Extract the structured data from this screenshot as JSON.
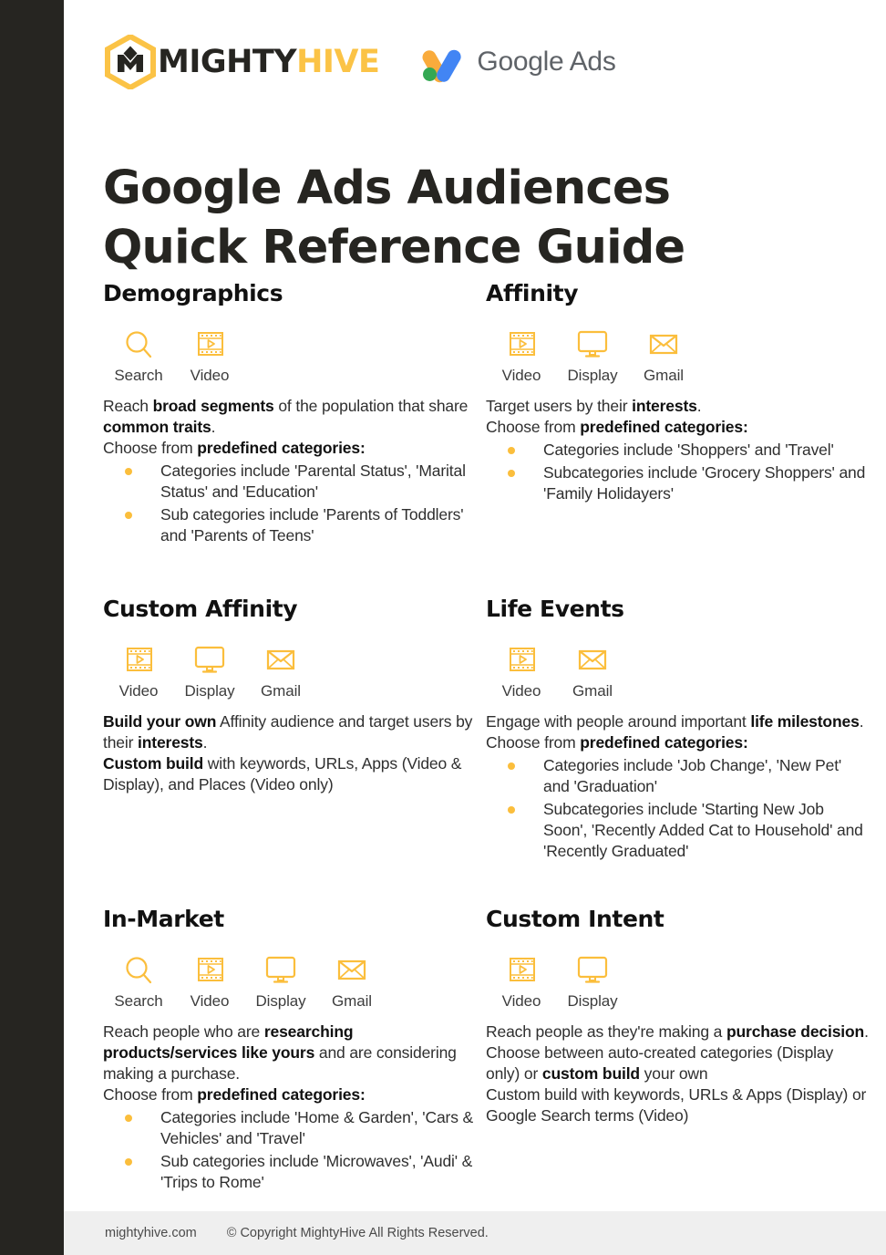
{
  "brand": {
    "mightyhive_mighty": "MIGHTY",
    "mightyhive_hive": "HIVE",
    "google_ads_text": "Google Ads",
    "accent_gold": "#FBC346",
    "bullet_gold": "#FBBE3C",
    "dark": "#262521"
  },
  "title": {
    "line1": "Google Ads Audiences",
    "line2": "Quick Reference Guide"
  },
  "sections": [
    {
      "id": "demographics",
      "title": "Demographics",
      "channels": [
        {
          "icon": "search-icon",
          "label": "Search"
        },
        {
          "icon": "video-icon",
          "label": "Video"
        }
      ],
      "paragraphs": [
        [
          {
            "t": "Reach ",
            "b": false
          },
          {
            "t": "broad segments",
            "b": true
          },
          {
            "t": " of the population that share ",
            "b": false
          },
          {
            "t": "common traits",
            "b": true
          },
          {
            "t": ".",
            "b": false
          }
        ],
        [
          {
            "t": "Choose from ",
            "b": false
          },
          {
            "t": "predefined categories:",
            "b": true
          }
        ]
      ],
      "bullets": [
        "Categories include 'Parental Status', 'Marital Status' and 'Education'",
        "Sub categories include 'Parents of Toddlers' and 'Parents of Teens'"
      ]
    },
    {
      "id": "affinity",
      "title": "Affinity",
      "channels": [
        {
          "icon": "video-icon",
          "label": "Video"
        },
        {
          "icon": "display-icon",
          "label": "Display"
        },
        {
          "icon": "gmail-icon",
          "label": "Gmail"
        }
      ],
      "paragraphs": [
        [
          {
            "t": "Target users by their ",
            "b": false
          },
          {
            "t": "interests",
            "b": true
          },
          {
            "t": ".",
            "b": false
          }
        ],
        [
          {
            "t": "Choose from ",
            "b": false
          },
          {
            "t": "predefined categories:",
            "b": true
          }
        ]
      ],
      "bullets": [
        "Categories include 'Shoppers' and 'Travel'",
        "Subcategories include 'Grocery Shoppers' and 'Family Holidayers'"
      ]
    },
    {
      "id": "custom-affinity",
      "title": "Custom Affinity",
      "channels": [
        {
          "icon": "video-icon",
          "label": "Video"
        },
        {
          "icon": "display-icon",
          "label": "Display"
        },
        {
          "icon": "gmail-icon",
          "label": "Gmail"
        }
      ],
      "paragraphs": [
        [
          {
            "t": "Build your own",
            "b": true
          },
          {
            "t": " Affinity audience and target users by their ",
            "b": false
          },
          {
            "t": "interests",
            "b": true
          },
          {
            "t": ".",
            "b": false
          }
        ],
        [
          {
            "t": "Custom build",
            "b": true
          },
          {
            "t": " with keywords, URLs, Apps (Video & Display), and Places (Video only)",
            "b": false
          }
        ]
      ],
      "bullets": []
    },
    {
      "id": "life-events",
      "title": "Life Events",
      "channels": [
        {
          "icon": "video-icon",
          "label": "Video"
        },
        {
          "icon": "gmail-icon",
          "label": "Gmail"
        }
      ],
      "paragraphs": [
        [
          {
            "t": "Engage with people around important ",
            "b": false
          },
          {
            "t": "life milestones",
            "b": true
          },
          {
            "t": ".",
            "b": false
          }
        ],
        [
          {
            "t": "Choose from ",
            "b": false
          },
          {
            "t": "predefined categories:",
            "b": true
          }
        ]
      ],
      "bullets": [
        "Categories include 'Job Change', 'New Pet' and 'Graduation'",
        "Subcategories include 'Starting New Job Soon', 'Recently Added Cat to Household' and 'Recently Graduated'"
      ]
    },
    {
      "id": "in-market",
      "title": "In-Market",
      "channels": [
        {
          "icon": "search-icon",
          "label": "Search"
        },
        {
          "icon": "video-icon",
          "label": "Video"
        },
        {
          "icon": "display-icon",
          "label": "Display"
        },
        {
          "icon": "gmail-icon",
          "label": "Gmail"
        }
      ],
      "paragraphs": [
        [
          {
            "t": "Reach people who are ",
            "b": false
          },
          {
            "t": "researching products/services like yours",
            "b": true
          },
          {
            "t": " and are considering making a purchase.",
            "b": false
          }
        ],
        [
          {
            "t": "Choose from ",
            "b": false
          },
          {
            "t": "predefined categories:",
            "b": true
          }
        ]
      ],
      "bullets": [
        "Categories include 'Home & Garden', 'Cars & Vehicles' and 'Travel'",
        "Sub categories include  'Microwaves', 'Audi' & 'Trips to Rome'"
      ]
    },
    {
      "id": "custom-intent",
      "title": "Custom Intent",
      "channels": [
        {
          "icon": "video-icon",
          "label": "Video"
        },
        {
          "icon": "display-icon",
          "label": "Display"
        }
      ],
      "paragraphs": [
        [
          {
            "t": "Reach people as they're making a ",
            "b": false
          },
          {
            "t": "purchase decision",
            "b": true
          },
          {
            "t": ".",
            "b": false
          }
        ],
        [
          {
            "t": "Choose between auto-created categories (Display only) or ",
            "b": false
          },
          {
            "t": "custom build",
            "b": true
          },
          {
            "t": " your own",
            "b": false
          }
        ],
        [
          {
            "t": "Custom build with keywords, URLs & Apps (Display) or Google Search terms (Video)",
            "b": false
          }
        ]
      ],
      "bullets": []
    }
  ],
  "footer": {
    "site": "mightyhive.com",
    "copyright": "© Copyright MightyHive All Rights Reserved."
  }
}
